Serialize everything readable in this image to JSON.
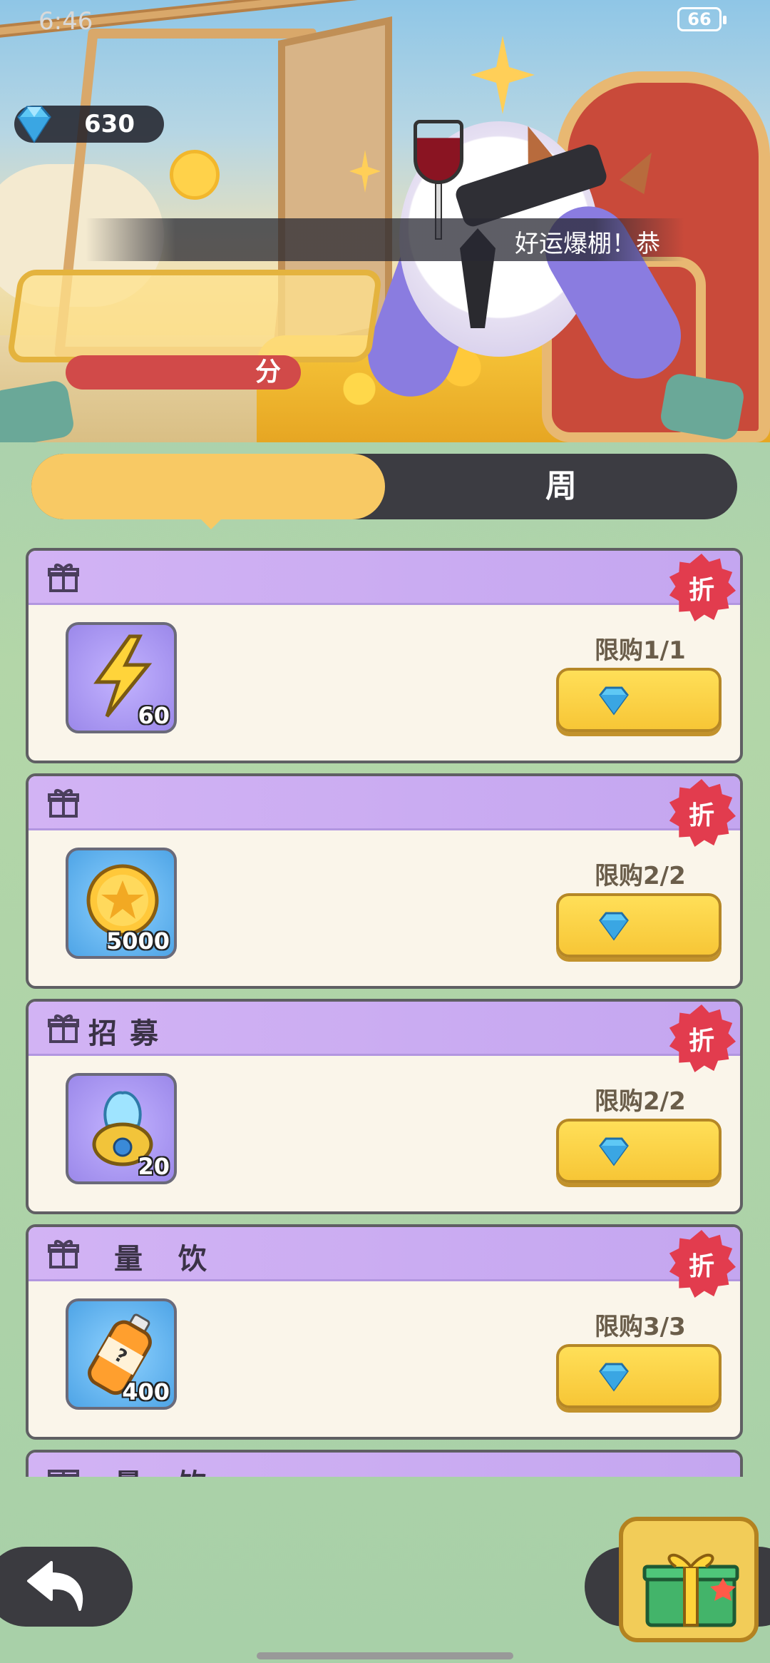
{
  "status_bar": {
    "time": "6:46",
    "battery": "66"
  },
  "currency": {
    "icon": "diamond-icon",
    "amount": "630"
  },
  "marquee": {
    "text": "好运爆棚！恭"
  },
  "banner": {
    "score_label": "分"
  },
  "tabs": [
    {
      "label": "",
      "active": true
    },
    {
      "label": "周",
      "active": false
    }
  ],
  "cards": [
    {
      "title": "",
      "badge": "折",
      "item_icon": "lightning-icon",
      "quantity": "60",
      "limit": "限购1/1",
      "price": ""
    },
    {
      "title": "",
      "badge": "折",
      "item_icon": "gold-coin-icon",
      "quantity": "5000",
      "limit": "限购2/2",
      "price": ""
    },
    {
      "title": "招募",
      "badge": "折",
      "item_icon": "recruit-orb-icon",
      "quantity": "20",
      "limit": "限购2/2",
      "price": ""
    },
    {
      "title": "量 饮",
      "badge": "折",
      "item_icon": "energy-drink-icon",
      "quantity": "400",
      "limit": "限购3/3",
      "price": ""
    },
    {
      "title": "量 饮",
      "badge": "",
      "item_icon": "",
      "quantity": "",
      "limit": "",
      "price": ""
    }
  ],
  "colors": {
    "tab_active": "#f8c964",
    "card_header": "#c4a6f0",
    "buy_button": "#f7c636",
    "discount_badge": "#e23c4e"
  }
}
